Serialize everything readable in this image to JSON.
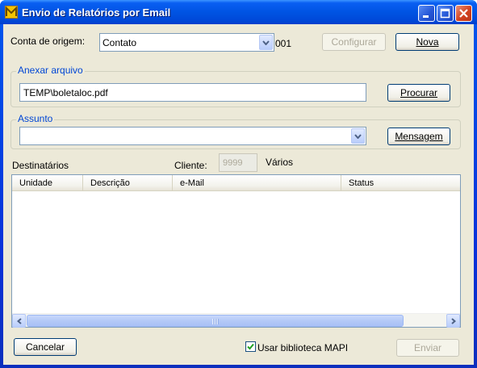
{
  "window": {
    "title": "Envio de Relatórios por Email",
    "app_icon": "mail-m-icon",
    "controls": [
      "minimize-icon",
      "maximize-icon",
      "close-icon"
    ]
  },
  "origin": {
    "label": "Conta de origem:",
    "selected": "Contato",
    "code": "001",
    "configure_label": "Configurar",
    "new_label": "Nova"
  },
  "attach": {
    "legend": "Anexar arquivo",
    "value": "TEMP\\boletaloc.pdf",
    "browse_label": "Procurar"
  },
  "subject": {
    "legend": "Assunto",
    "value": "",
    "message_label": "Mensagem"
  },
  "recipients": {
    "label": "Destinatários",
    "client_label": "Cliente:",
    "client_value": "9999",
    "client_extra": "Vários",
    "columns": [
      "Unidade",
      "Descrição",
      "e-Mail",
      "Status"
    ],
    "rows": []
  },
  "footer": {
    "cancel_label": "Cancelar",
    "mapi_label": "Usar biblioteca MAPI",
    "mapi_checked": true,
    "send_label": "Enviar"
  },
  "colors": {
    "title_bar": "#0054e3",
    "client_bg": "#ece9d8",
    "group_legend": "#0046d5"
  }
}
